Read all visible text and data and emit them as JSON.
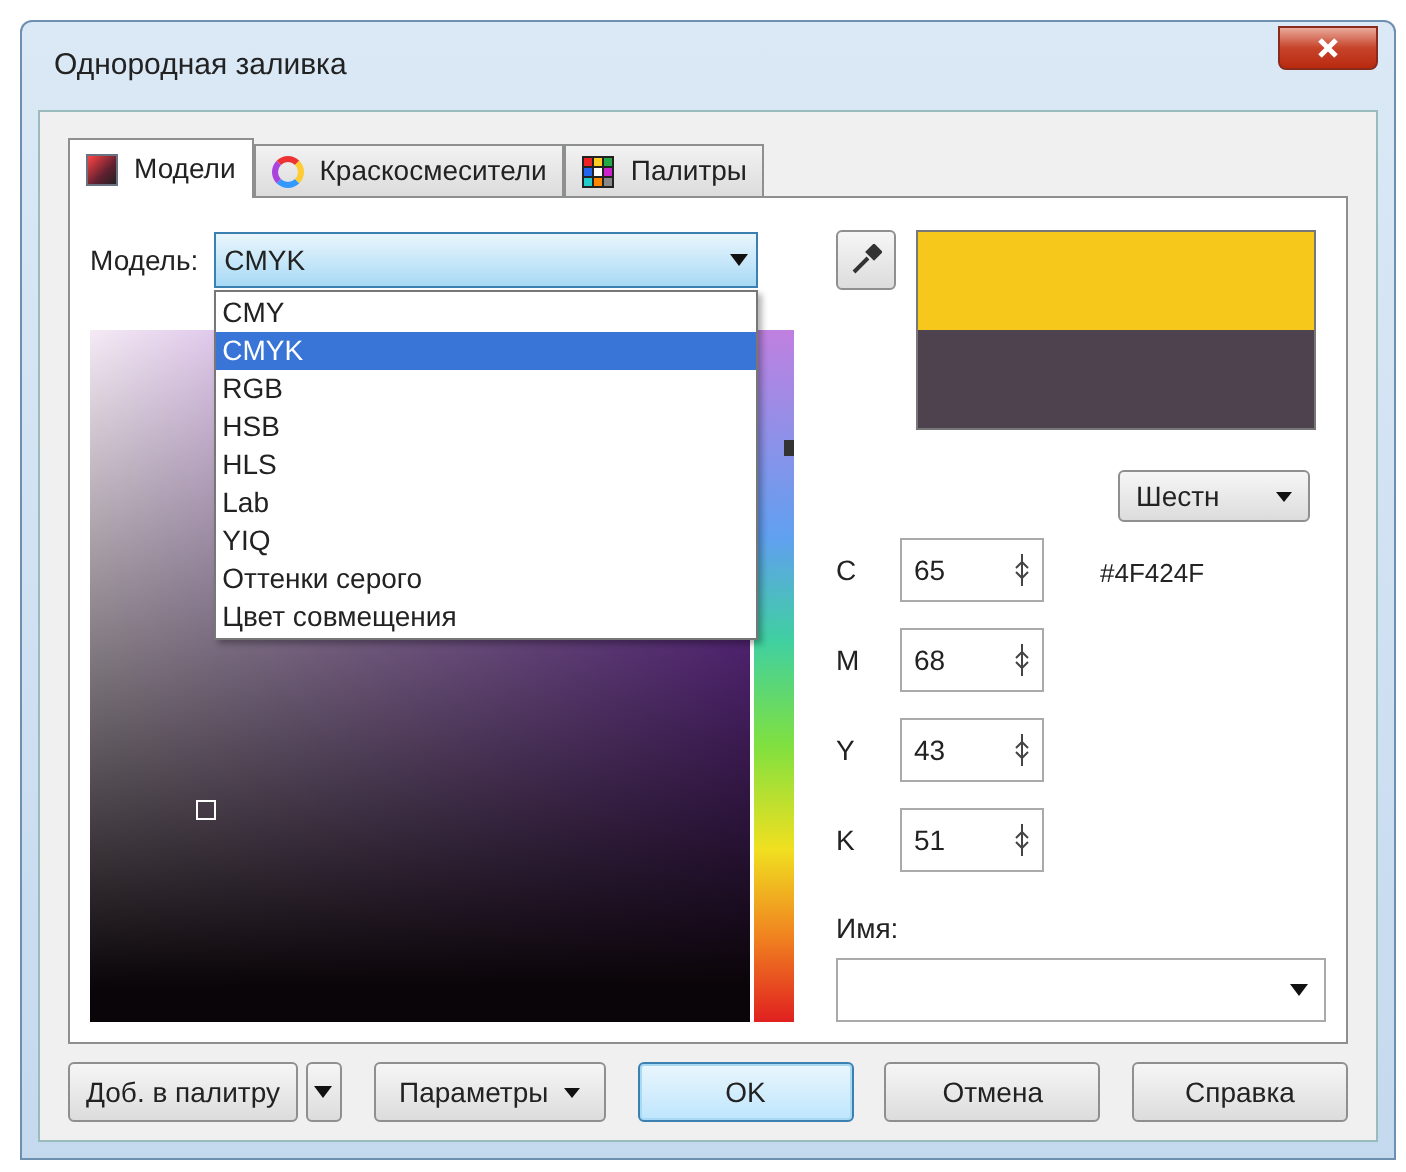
{
  "window": {
    "title": "Однородная заливка"
  },
  "tabs": [
    {
      "label": "Модели",
      "selected": true,
      "kind": "models"
    },
    {
      "label": "Краскосмесители",
      "selected": false,
      "kind": "mixers"
    },
    {
      "label": "Палитры",
      "selected": false,
      "kind": "palettes"
    }
  ],
  "model": {
    "label": "Модель:",
    "value": "CMYK",
    "expanded": true,
    "options": [
      {
        "label": "CMY",
        "selected": false
      },
      {
        "label": "CMYK",
        "selected": true
      },
      {
        "label": "RGB",
        "selected": false
      },
      {
        "label": "HSB",
        "selected": false
      },
      {
        "label": "HLS",
        "selected": false
      },
      {
        "label": "Lab",
        "selected": false
      },
      {
        "label": "YIQ",
        "selected": false
      },
      {
        "label": "Оттенки серого",
        "selected": false
      },
      {
        "label": "Цвет совмещения",
        "selected": false
      }
    ]
  },
  "hue": {
    "level": 0.83
  },
  "format_button": "Шестн",
  "hex_value": "#4F424F",
  "components": [
    {
      "label": "C",
      "value": "65"
    },
    {
      "label": "M",
      "value": "68"
    },
    {
      "label": "Y",
      "value": "43"
    },
    {
      "label": "K",
      "value": "51"
    }
  ],
  "name": {
    "label": "Имя:"
  },
  "buttons": [
    {
      "label": "Доб. в палитру",
      "kind": "split"
    },
    {
      "label": "Параметры",
      "kind": "menu"
    },
    {
      "label": "OK",
      "kind": "default"
    },
    {
      "label": "Отмена",
      "kind": "plain"
    },
    {
      "label": "Справка",
      "kind": "plain"
    }
  ]
}
